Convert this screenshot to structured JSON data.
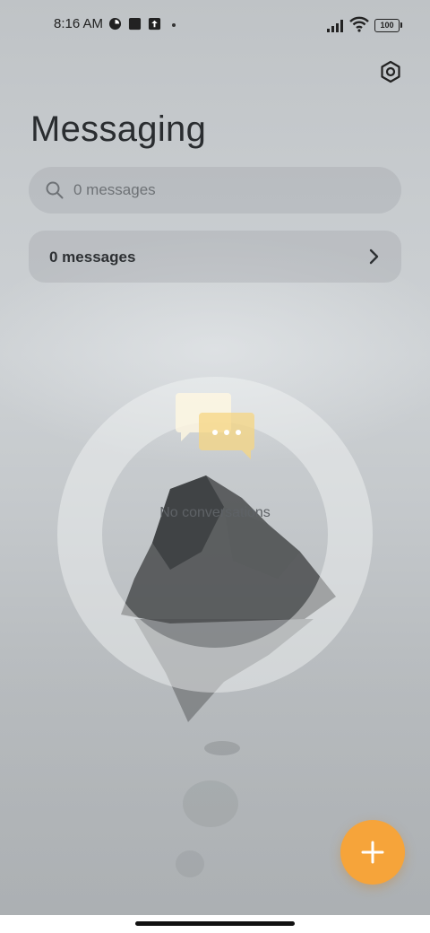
{
  "status_bar": {
    "time": "8:16 AM",
    "battery": "100",
    "icons": [
      "app-notification-icon",
      "square-notification-icon",
      "upload-notification-icon",
      "signal-icon",
      "wifi-icon",
      "battery-icon"
    ]
  },
  "header": {
    "title": "Messaging",
    "settings_icon": "settings-hexagon-icon"
  },
  "search": {
    "placeholder": "0 messages",
    "icon": "search-icon"
  },
  "messages_row": {
    "label": "0 messages",
    "icon": "chevron-right-icon"
  },
  "empty_state": {
    "text": "No conversations",
    "icon": "chat-bubbles-icon"
  },
  "fab": {
    "icon": "plus-icon",
    "color": "#f6a43a"
  },
  "colors": {
    "accent": "#f6a43a",
    "title": "#2a2d30"
  }
}
